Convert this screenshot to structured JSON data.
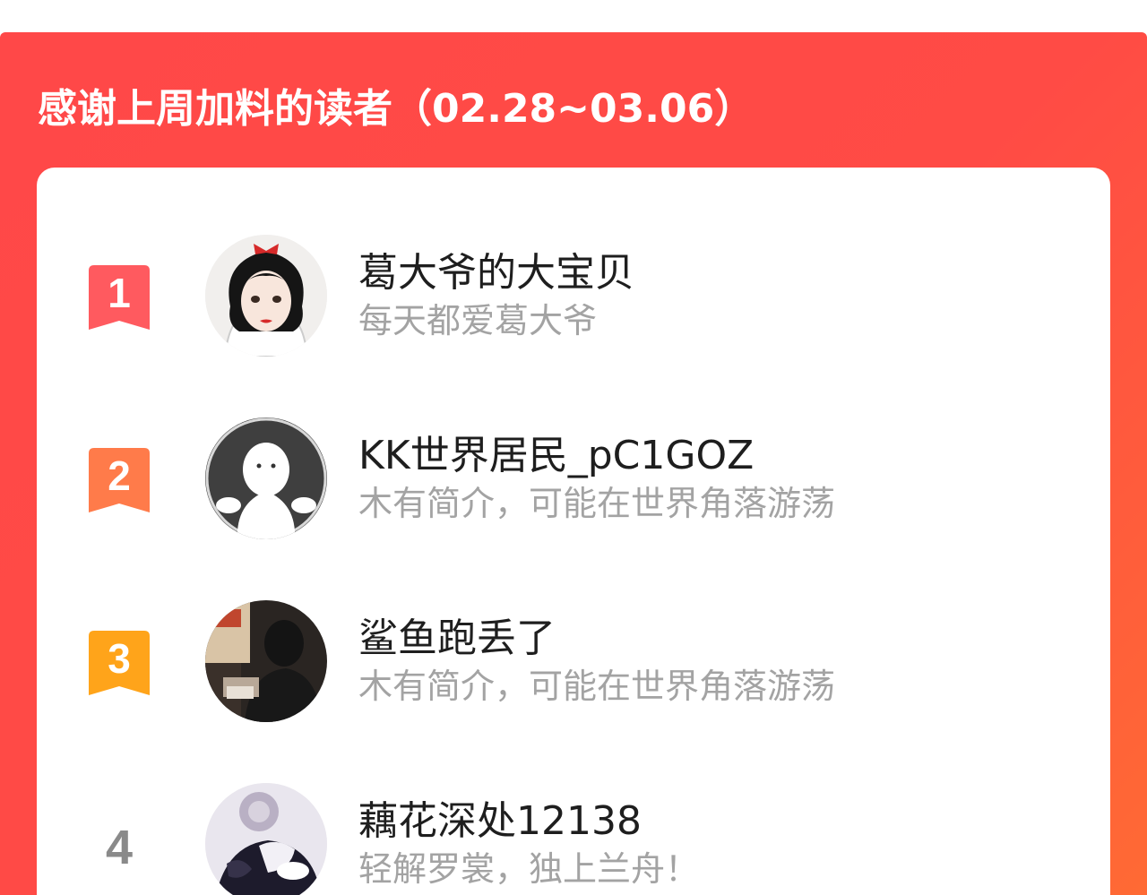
{
  "header": {
    "title": "感谢上周加料的读者（02.28~03.06）"
  },
  "colors": {
    "panel_red": "#ff4848",
    "panel_orange": "#ff6a34",
    "rank1": "#ff5a5f",
    "rank2": "#ff7b4a",
    "rank3": "#ffa41a",
    "rank_plain": "#8a8a8a",
    "name": "#1e1e1e",
    "bio": "#a3a3a3"
  },
  "readers": [
    {
      "rank": "1",
      "name": "葛大爷的大宝贝",
      "bio": "每天都爱葛大爷",
      "avatar_icon": "cartoon-girl-avatar"
    },
    {
      "rank": "2",
      "name": "KK世界居民_pC1GOZ",
      "bio": "木有简介，可能在世界角落游荡",
      "avatar_icon": "default-ghost-avatar"
    },
    {
      "rank": "3",
      "name": "鲨鱼跑丢了",
      "bio": "木有简介，可能在世界角落游荡",
      "avatar_icon": "photo-avatar"
    },
    {
      "rank": "4",
      "name": "藕花深处12138",
      "bio": "轻解罗裳，独上兰舟！",
      "avatar_icon": "anime-photo-avatar"
    }
  ]
}
